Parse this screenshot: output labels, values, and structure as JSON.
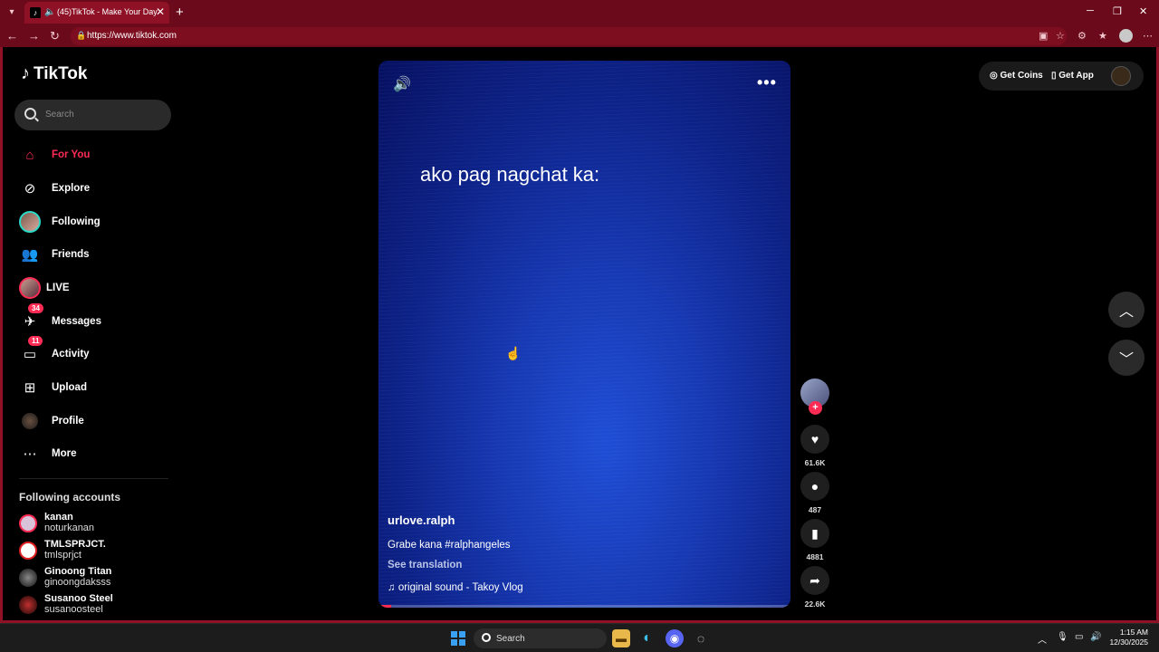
{
  "browser": {
    "tab_title": "(45)TikTok - Make Your Day",
    "url": "https://www.tiktok.com",
    "accent": "#6b0a1a"
  },
  "sidebar": {
    "logo_text": "TikTok",
    "search_placeholder": "Search",
    "nav": [
      {
        "label": "For You",
        "icon": "home-icon",
        "active": true
      },
      {
        "label": "Explore",
        "icon": "compass-icon"
      },
      {
        "label": "Following",
        "icon": "following-avatar"
      },
      {
        "label": "Friends",
        "icon": "friends-icon"
      },
      {
        "label": "LIVE",
        "icon": "live-avatar"
      },
      {
        "label": "Messages",
        "icon": "messages-icon",
        "badge": "34"
      },
      {
        "label": "Activity",
        "icon": "activity-icon",
        "badge": "11"
      },
      {
        "label": "Upload",
        "icon": "upload-icon"
      },
      {
        "label": "Profile",
        "icon": "profile-avatar"
      },
      {
        "label": "More",
        "icon": "more-icon"
      }
    ],
    "following_heading": "Following accounts",
    "accounts": [
      {
        "name": "kanan",
        "handle": "noturkanan"
      },
      {
        "name": "TMLSPRJCT.",
        "handle": "tmlsprjct"
      },
      {
        "name": "Ginoong Titan",
        "handle": "ginoongdaksss"
      },
      {
        "name": "Susanoo Steel",
        "handle": "susanoosteel"
      }
    ]
  },
  "video": {
    "overlay_text": "ako pag nagchat ka:",
    "author": "urlove.ralph",
    "description": "Grabe kana #ralphangeles",
    "see_translation": "See translation",
    "music": "original sound - Takoy Vlog",
    "progress": 0.03
  },
  "actions": {
    "likes": "61.6K",
    "comments": "487",
    "saves": "4881",
    "shares": "22.6K"
  },
  "topbar": {
    "get_coins": "Get Coins",
    "get_app": "Get App"
  },
  "taskbar": {
    "search": "Search",
    "time": "1:15 AM",
    "date": "12/30/2025"
  },
  "colors": {
    "brand": "#fe2c55"
  }
}
